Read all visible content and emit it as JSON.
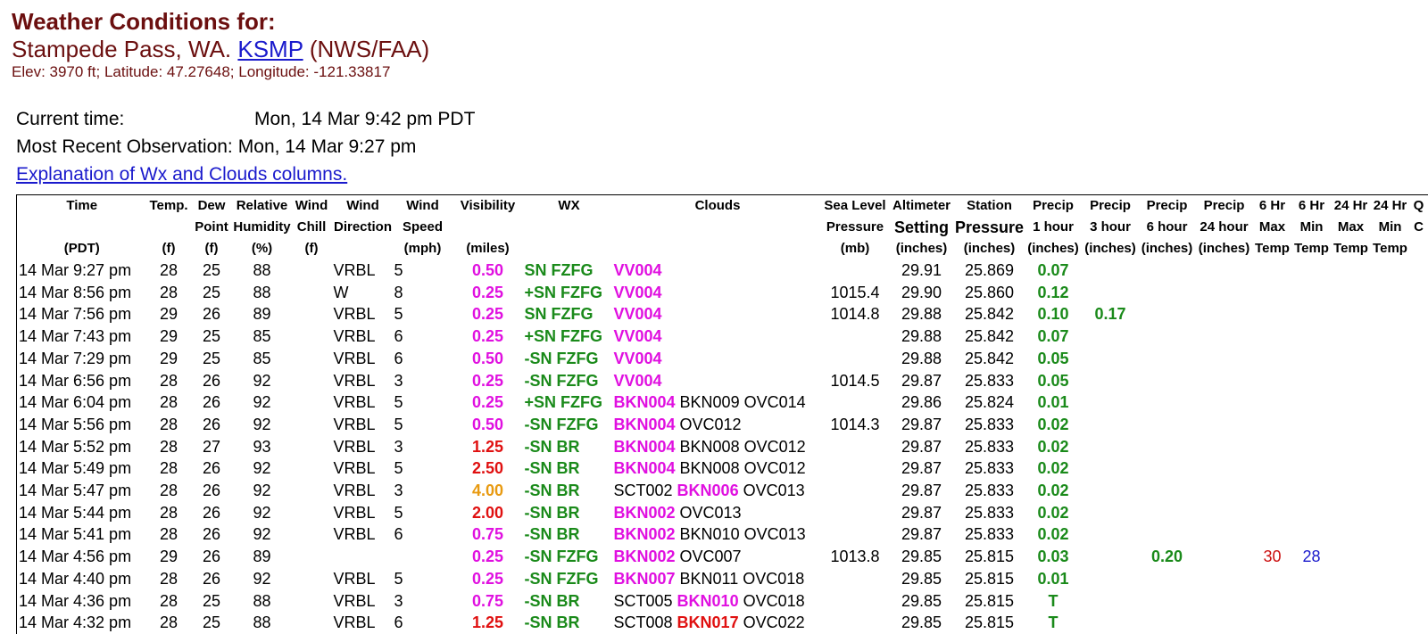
{
  "header": {
    "title": "Weather Conditions for:",
    "station_name": "Stampede Pass, WA.",
    "station_id": "KSMP",
    "source": "(NWS/FAA)",
    "elevation_line": "Elev: 3970 ft; Latitude: 47.27648; Longitude: -121.33817"
  },
  "info": {
    "current_time_label": "Current time:",
    "current_time_value": "Mon, 14 Mar 9:42 pm PDT",
    "recent_obs_label": "Most Recent Observation:",
    "recent_obs_value": "Mon, 14 Mar 9:27 pm",
    "explain_link": "Explanation of Wx and Clouds columns."
  },
  "columns": [
    [
      "Time",
      "",
      "(PDT)"
    ],
    [
      "Temp.",
      "",
      "(f)"
    ],
    [
      "Dew",
      "Point",
      "(f)"
    ],
    [
      "Relative",
      "Humidity",
      "(%)"
    ],
    [
      "Wind",
      "Chill",
      "(f)"
    ],
    [
      "Wind",
      "Direction",
      ""
    ],
    [
      "Wind",
      "Speed",
      "(mph)"
    ],
    [
      "Visibility",
      "",
      "(miles)"
    ],
    [
      "WX",
      "",
      ""
    ],
    [
      "Clouds",
      "",
      ""
    ],
    [
      "Sea Level",
      "Pressure",
      "(mb)"
    ],
    [
      "Altimeter",
      "Setting",
      "(inches)"
    ],
    [
      "Station",
      "Pressure",
      "(inches)"
    ],
    [
      "Precip",
      "1 hour",
      "(inches)"
    ],
    [
      "Precip",
      "3 hour",
      "(inches)"
    ],
    [
      "Precip",
      "6 hour",
      "(inches)"
    ],
    [
      "Precip",
      "24 hour",
      "(inches)"
    ],
    [
      "6 Hr",
      "Max",
      "Temp"
    ],
    [
      "6 Hr",
      "Min",
      "Temp"
    ],
    [
      "24 Hr",
      "Max",
      "Temp"
    ],
    [
      "24 Hr",
      "Min",
      "Temp"
    ],
    [
      "Q",
      "C",
      ""
    ]
  ],
  "rows": [
    {
      "time": "14 Mar 9:27 pm",
      "temp": "28",
      "dew": "25",
      "rh": "88",
      "chill": "",
      "dir": "VRBL",
      "spd": "5",
      "vis": "0.50",
      "visc": "mag",
      "wx": "SN FZFG",
      "clouds": [
        [
          "VV004",
          "mag"
        ]
      ],
      "slp": "",
      "alt": "29.91",
      "stp": "25.869",
      "p1": "0.07",
      "p3": "",
      "p6": "",
      "p24": "",
      "mx6": "",
      "mn6": "",
      "mx24": "",
      "mn24": ""
    },
    {
      "time": "14 Mar 8:56 pm",
      "temp": "28",
      "dew": "25",
      "rh": "88",
      "chill": "",
      "dir": "W",
      "spd": "8",
      "vis": "0.25",
      "visc": "mag",
      "wx": "+SN FZFG",
      "clouds": [
        [
          "VV004",
          "mag"
        ]
      ],
      "slp": "1015.4",
      "alt": "29.90",
      "stp": "25.860",
      "p1": "0.12",
      "p3": "",
      "p6": "",
      "p24": "",
      "mx6": "",
      "mn6": "",
      "mx24": "",
      "mn24": ""
    },
    {
      "time": "14 Mar 7:56 pm",
      "temp": "29",
      "dew": "26",
      "rh": "89",
      "chill": "",
      "dir": "VRBL",
      "spd": "5",
      "vis": "0.25",
      "visc": "mag",
      "wx": "SN FZFG",
      "clouds": [
        [
          "VV004",
          "mag"
        ]
      ],
      "slp": "1014.8",
      "alt": "29.88",
      "stp": "25.842",
      "p1": "0.10",
      "p3": "0.17",
      "p6": "",
      "p24": "",
      "mx6": "",
      "mn6": "",
      "mx24": "",
      "mn24": ""
    },
    {
      "time": "14 Mar 7:43 pm",
      "temp": "29",
      "dew": "25",
      "rh": "85",
      "chill": "",
      "dir": "VRBL",
      "spd": "6",
      "vis": "0.25",
      "visc": "mag",
      "wx": "+SN FZFG",
      "clouds": [
        [
          "VV004",
          "mag"
        ]
      ],
      "slp": "",
      "alt": "29.88",
      "stp": "25.842",
      "p1": "0.07",
      "p3": "",
      "p6": "",
      "p24": "",
      "mx6": "",
      "mn6": "",
      "mx24": "",
      "mn24": ""
    },
    {
      "time": "14 Mar 7:29 pm",
      "temp": "29",
      "dew": "25",
      "rh": "85",
      "chill": "",
      "dir": "VRBL",
      "spd": "6",
      "vis": "0.50",
      "visc": "mag",
      "wx": "-SN FZFG",
      "clouds": [
        [
          "VV004",
          "mag"
        ]
      ],
      "slp": "",
      "alt": "29.88",
      "stp": "25.842",
      "p1": "0.05",
      "p3": "",
      "p6": "",
      "p24": "",
      "mx6": "",
      "mn6": "",
      "mx24": "",
      "mn24": ""
    },
    {
      "time": "14 Mar 6:56 pm",
      "temp": "28",
      "dew": "26",
      "rh": "92",
      "chill": "",
      "dir": "VRBL",
      "spd": "3",
      "vis": "0.25",
      "visc": "mag",
      "wx": "-SN FZFG",
      "clouds": [
        [
          "VV004",
          "mag"
        ]
      ],
      "slp": "1014.5",
      "alt": "29.87",
      "stp": "25.833",
      "p1": "0.05",
      "p3": "",
      "p6": "",
      "p24": "",
      "mx6": "",
      "mn6": "",
      "mx24": "",
      "mn24": ""
    },
    {
      "time": "14 Mar 6:04 pm",
      "temp": "28",
      "dew": "26",
      "rh": "92",
      "chill": "",
      "dir": "VRBL",
      "spd": "5",
      "vis": "0.25",
      "visc": "mag",
      "wx": "+SN FZFG",
      "clouds": [
        [
          "BKN004",
          "mag"
        ],
        [
          "BKN009",
          ""
        ],
        [
          "OVC014",
          ""
        ]
      ],
      "slp": "",
      "alt": "29.86",
      "stp": "25.824",
      "p1": "0.01",
      "p3": "",
      "p6": "",
      "p24": "",
      "mx6": "",
      "mn6": "",
      "mx24": "",
      "mn24": ""
    },
    {
      "time": "14 Mar 5:56 pm",
      "temp": "28",
      "dew": "26",
      "rh": "92",
      "chill": "",
      "dir": "VRBL",
      "spd": "5",
      "vis": "0.50",
      "visc": "mag",
      "wx": "-SN FZFG",
      "clouds": [
        [
          "BKN004",
          "mag"
        ],
        [
          "OVC012",
          ""
        ]
      ],
      "slp": "1014.3",
      "alt": "29.87",
      "stp": "25.833",
      "p1": "0.02",
      "p3": "",
      "p6": "",
      "p24": "",
      "mx6": "",
      "mn6": "",
      "mx24": "",
      "mn24": ""
    },
    {
      "time": "14 Mar 5:52 pm",
      "temp": "28",
      "dew": "27",
      "rh": "93",
      "chill": "",
      "dir": "VRBL",
      "spd": "3",
      "vis": "1.25",
      "visc": "red",
      "wx": "-SN BR",
      "clouds": [
        [
          "BKN004",
          "mag"
        ],
        [
          "BKN008",
          ""
        ],
        [
          "OVC012",
          ""
        ]
      ],
      "slp": "",
      "alt": "29.87",
      "stp": "25.833",
      "p1": "0.02",
      "p3": "",
      "p6": "",
      "p24": "",
      "mx6": "",
      "mn6": "",
      "mx24": "",
      "mn24": ""
    },
    {
      "time": "14 Mar 5:49 pm",
      "temp": "28",
      "dew": "26",
      "rh": "92",
      "chill": "",
      "dir": "VRBL",
      "spd": "5",
      "vis": "2.50",
      "visc": "red",
      "wx": "-SN BR",
      "clouds": [
        [
          "BKN004",
          "mag"
        ],
        [
          "BKN008",
          ""
        ],
        [
          "OVC012",
          ""
        ]
      ],
      "slp": "",
      "alt": "29.87",
      "stp": "25.833",
      "p1": "0.02",
      "p3": "",
      "p6": "",
      "p24": "",
      "mx6": "",
      "mn6": "",
      "mx24": "",
      "mn24": ""
    },
    {
      "time": "14 Mar 5:47 pm",
      "temp": "28",
      "dew": "26",
      "rh": "92",
      "chill": "",
      "dir": "VRBL",
      "spd": "3",
      "vis": "4.00",
      "visc": "org",
      "wx": "-SN BR",
      "clouds": [
        [
          "SCT002",
          ""
        ],
        [
          "BKN006",
          "mag"
        ],
        [
          "OVC013",
          ""
        ]
      ],
      "slp": "",
      "alt": "29.87",
      "stp": "25.833",
      "p1": "0.02",
      "p3": "",
      "p6": "",
      "p24": "",
      "mx6": "",
      "mn6": "",
      "mx24": "",
      "mn24": ""
    },
    {
      "time": "14 Mar 5:44 pm",
      "temp": "28",
      "dew": "26",
      "rh": "92",
      "chill": "",
      "dir": "VRBL",
      "spd": "5",
      "vis": "2.00",
      "visc": "red",
      "wx": "-SN BR",
      "clouds": [
        [
          "BKN002",
          "mag"
        ],
        [
          "OVC013",
          ""
        ]
      ],
      "slp": "",
      "alt": "29.87",
      "stp": "25.833",
      "p1": "0.02",
      "p3": "",
      "p6": "",
      "p24": "",
      "mx6": "",
      "mn6": "",
      "mx24": "",
      "mn24": ""
    },
    {
      "time": "14 Mar 5:41 pm",
      "temp": "28",
      "dew": "26",
      "rh": "92",
      "chill": "",
      "dir": "VRBL",
      "spd": "6",
      "vis": "0.75",
      "visc": "mag",
      "wx": "-SN BR",
      "clouds": [
        [
          "BKN002",
          "mag"
        ],
        [
          "BKN010",
          ""
        ],
        [
          "OVC013",
          ""
        ]
      ],
      "slp": "",
      "alt": "29.87",
      "stp": "25.833",
      "p1": "0.02",
      "p3": "",
      "p6": "",
      "p24": "",
      "mx6": "",
      "mn6": "",
      "mx24": "",
      "mn24": ""
    },
    {
      "time": "14 Mar 4:56 pm",
      "temp": "29",
      "dew": "26",
      "rh": "89",
      "chill": "",
      "dir": "",
      "spd": "",
      "vis": "0.25",
      "visc": "mag",
      "wx": "-SN FZFG",
      "clouds": [
        [
          "BKN002",
          "mag"
        ],
        [
          "OVC007",
          ""
        ]
      ],
      "slp": "1013.8",
      "alt": "29.85",
      "stp": "25.815",
      "p1": "0.03",
      "p3": "",
      "p6": "0.20",
      "p24": "",
      "mx6": "30",
      "mn6": "28",
      "mx24": "",
      "mn24": ""
    },
    {
      "time": "14 Mar 4:40 pm",
      "temp": "28",
      "dew": "26",
      "rh": "92",
      "chill": "",
      "dir": "VRBL",
      "spd": "5",
      "vis": "0.25",
      "visc": "mag",
      "wx": "-SN FZFG",
      "clouds": [
        [
          "BKN007",
          "mag"
        ],
        [
          "BKN011",
          ""
        ],
        [
          "OVC018",
          ""
        ]
      ],
      "slp": "",
      "alt": "29.85",
      "stp": "25.815",
      "p1": "0.01",
      "p3": "",
      "p6": "",
      "p24": "",
      "mx6": "",
      "mn6": "",
      "mx24": "",
      "mn24": ""
    },
    {
      "time": "14 Mar 4:36 pm",
      "temp": "28",
      "dew": "25",
      "rh": "88",
      "chill": "",
      "dir": "VRBL",
      "spd": "3",
      "vis": "0.75",
      "visc": "mag",
      "wx": "-SN BR",
      "clouds": [
        [
          "SCT005",
          ""
        ],
        [
          "BKN010",
          "mag"
        ],
        [
          "OVC018",
          ""
        ]
      ],
      "slp": "",
      "alt": "29.85",
      "stp": "25.815",
      "p1": "T",
      "p3": "",
      "p6": "",
      "p24": "",
      "mx6": "",
      "mn6": "",
      "mx24": "",
      "mn24": ""
    },
    {
      "time": "14 Mar 4:32 pm",
      "temp": "28",
      "dew": "25",
      "rh": "88",
      "chill": "",
      "dir": "VRBL",
      "spd": "6",
      "vis": "1.25",
      "visc": "red",
      "wx": "-SN BR",
      "clouds": [
        [
          "SCT008",
          ""
        ],
        [
          "BKN017",
          "red"
        ],
        [
          "OVC022",
          ""
        ]
      ],
      "slp": "",
      "alt": "29.85",
      "stp": "25.815",
      "p1": "T",
      "p3": "",
      "p6": "",
      "p24": "",
      "mx6": "",
      "mn6": "",
      "mx24": "",
      "mn24": ""
    }
  ],
  "colors": {
    "title": "#6b0f0f",
    "link": "#1a1acc",
    "magenta": "#e010e0",
    "green": "#1a8a1a",
    "red": "#e01010",
    "orange": "#e89a10"
  }
}
